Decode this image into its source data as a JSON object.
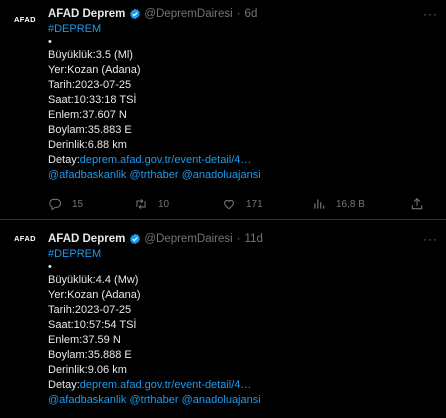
{
  "tweets": [
    {
      "name": "AFAD Deprem",
      "handle": "@DepremDairesi",
      "time": "6d",
      "avatar_text": "AFAD",
      "hashtag": "#DEPREM",
      "bullet": "•",
      "magnitude": "Büyüklük:3.5 (Ml)",
      "location": "Yer:Kozan (Adana)",
      "date": "Tarih:2023-07-25",
      "clock": "Saat:10:33:18 TSİ",
      "lat": "Enlem:37.607 N",
      "lon": "Boylam:35.883 E",
      "depth": "Derinlik:6.88 km",
      "detail_label": "Detay:",
      "detail_link": "deprem.afad.gov.tr/event-detail/4…",
      "mentions": "@afadbaskanlik @trthaber @anadoluajansi",
      "replies": "15",
      "retweets": "10",
      "likes": "171",
      "views": "16,8 B"
    },
    {
      "name": "AFAD Deprem",
      "handle": "@DepremDairesi",
      "time": "11d",
      "avatar_text": "AFAD",
      "hashtag": "#DEPREM",
      "bullet": "•",
      "magnitude": "Büyüklük:4.4 (Mw)",
      "location": "Yer:Kozan (Adana)",
      "date": "Tarih:2023-07-25",
      "clock": "Saat:10:57:54 TSİ",
      "lat": "Enlem:37.59 N",
      "lon": "Boylam:35.888 E",
      "depth": "Derinlik:9.06 km",
      "detail_label": "Detay:",
      "detail_link": "deprem.afad.gov.tr/event-detail/4…",
      "mentions": "@afadbaskanlik @trthaber @anadoluajansi"
    }
  ],
  "more_glyph": "···",
  "dot": "·",
  "colors": {
    "background": "#000000",
    "text": "#e7e9ea",
    "muted": "#71767b",
    "link": "#1d9bf0",
    "divider": "#2f3336"
  },
  "icons": [
    "verified-badge-icon",
    "more-icon",
    "reply-icon",
    "retweet-icon",
    "like-icon",
    "views-icon",
    "share-icon"
  ]
}
